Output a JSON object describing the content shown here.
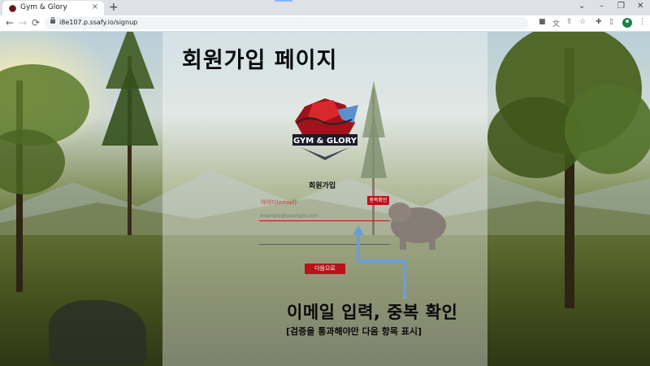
{
  "browser": {
    "tab_title": "Gym & Glory",
    "tab_close": "×",
    "new_tab": "+",
    "url": "i8e107.p.ssafy.io/signup",
    "window_controls": {
      "dropdown": "⌄",
      "minimize": "–",
      "restore": "❐",
      "close": "✕"
    }
  },
  "page": {
    "heading": "회원가입 페이지",
    "logo_text": "GYM & GLORY",
    "form_title": "회원가입",
    "id_label": "아이디(email)",
    "check_duplicate_label": "중복확인",
    "email_placeholder": "example@example.com",
    "next_button_label": "다음으로"
  },
  "annotation": {
    "main": "이메일 입력, 중복 확인",
    "sub": "[검증을 통과해야만 다음 항목 표시]",
    "arrow_color": "#6a9ed6"
  },
  "colors": {
    "accent_red": "#b8131a"
  }
}
